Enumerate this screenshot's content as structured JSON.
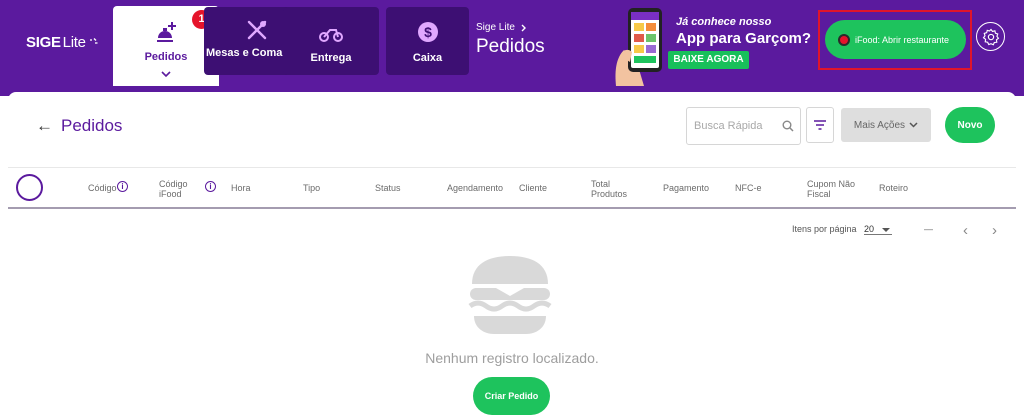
{
  "app": {
    "logo_main": "SIGE",
    "logo_sub": "Lite"
  },
  "nav": {
    "tabs": [
      {
        "label": "Pedidos",
        "icon": "utensils-plus-icon",
        "active": true,
        "badge": "1"
      },
      {
        "label": "Mesas e Comandas",
        "icon": "fork-knife-icon",
        "active": false
      },
      {
        "label": "Entrega",
        "icon": "motorcycle-icon",
        "active": false
      },
      {
        "label": "Caixa",
        "icon": "dollar-coin-icon",
        "active": false
      }
    ]
  },
  "breadcrumb": {
    "parent": "Sige Lite",
    "current": "Pedidos"
  },
  "promo": {
    "line1": "Já conhece nosso",
    "line2": "App para Garçom?",
    "button": "BAIXE AGORA"
  },
  "ifood": {
    "label": "iFood: Abrir restaurante"
  },
  "page": {
    "title": "Pedidos"
  },
  "toolbar": {
    "search_placeholder": "Busca Rápida",
    "more_actions": "Mais Ações",
    "new": "Novo"
  },
  "table": {
    "headers": [
      "Código",
      "Código iFood",
      "Hora",
      "Tipo",
      "Status",
      "Agendamento",
      "Cliente",
      "Total Produtos",
      "Pagamento",
      "NFC-e",
      "Cupom Não Fiscal",
      "Roteiro"
    ]
  },
  "pagination": {
    "items_per_page_label": "Itens por página",
    "items_per_page": "20",
    "range": "—"
  },
  "empty_state": {
    "message": "Nenhum registro localizado.",
    "button": "Criar Pedido"
  },
  "colors": {
    "brand_purple": "#5b1a9e",
    "accent_green": "#1ec35d",
    "badge_red": "#e5142b"
  }
}
